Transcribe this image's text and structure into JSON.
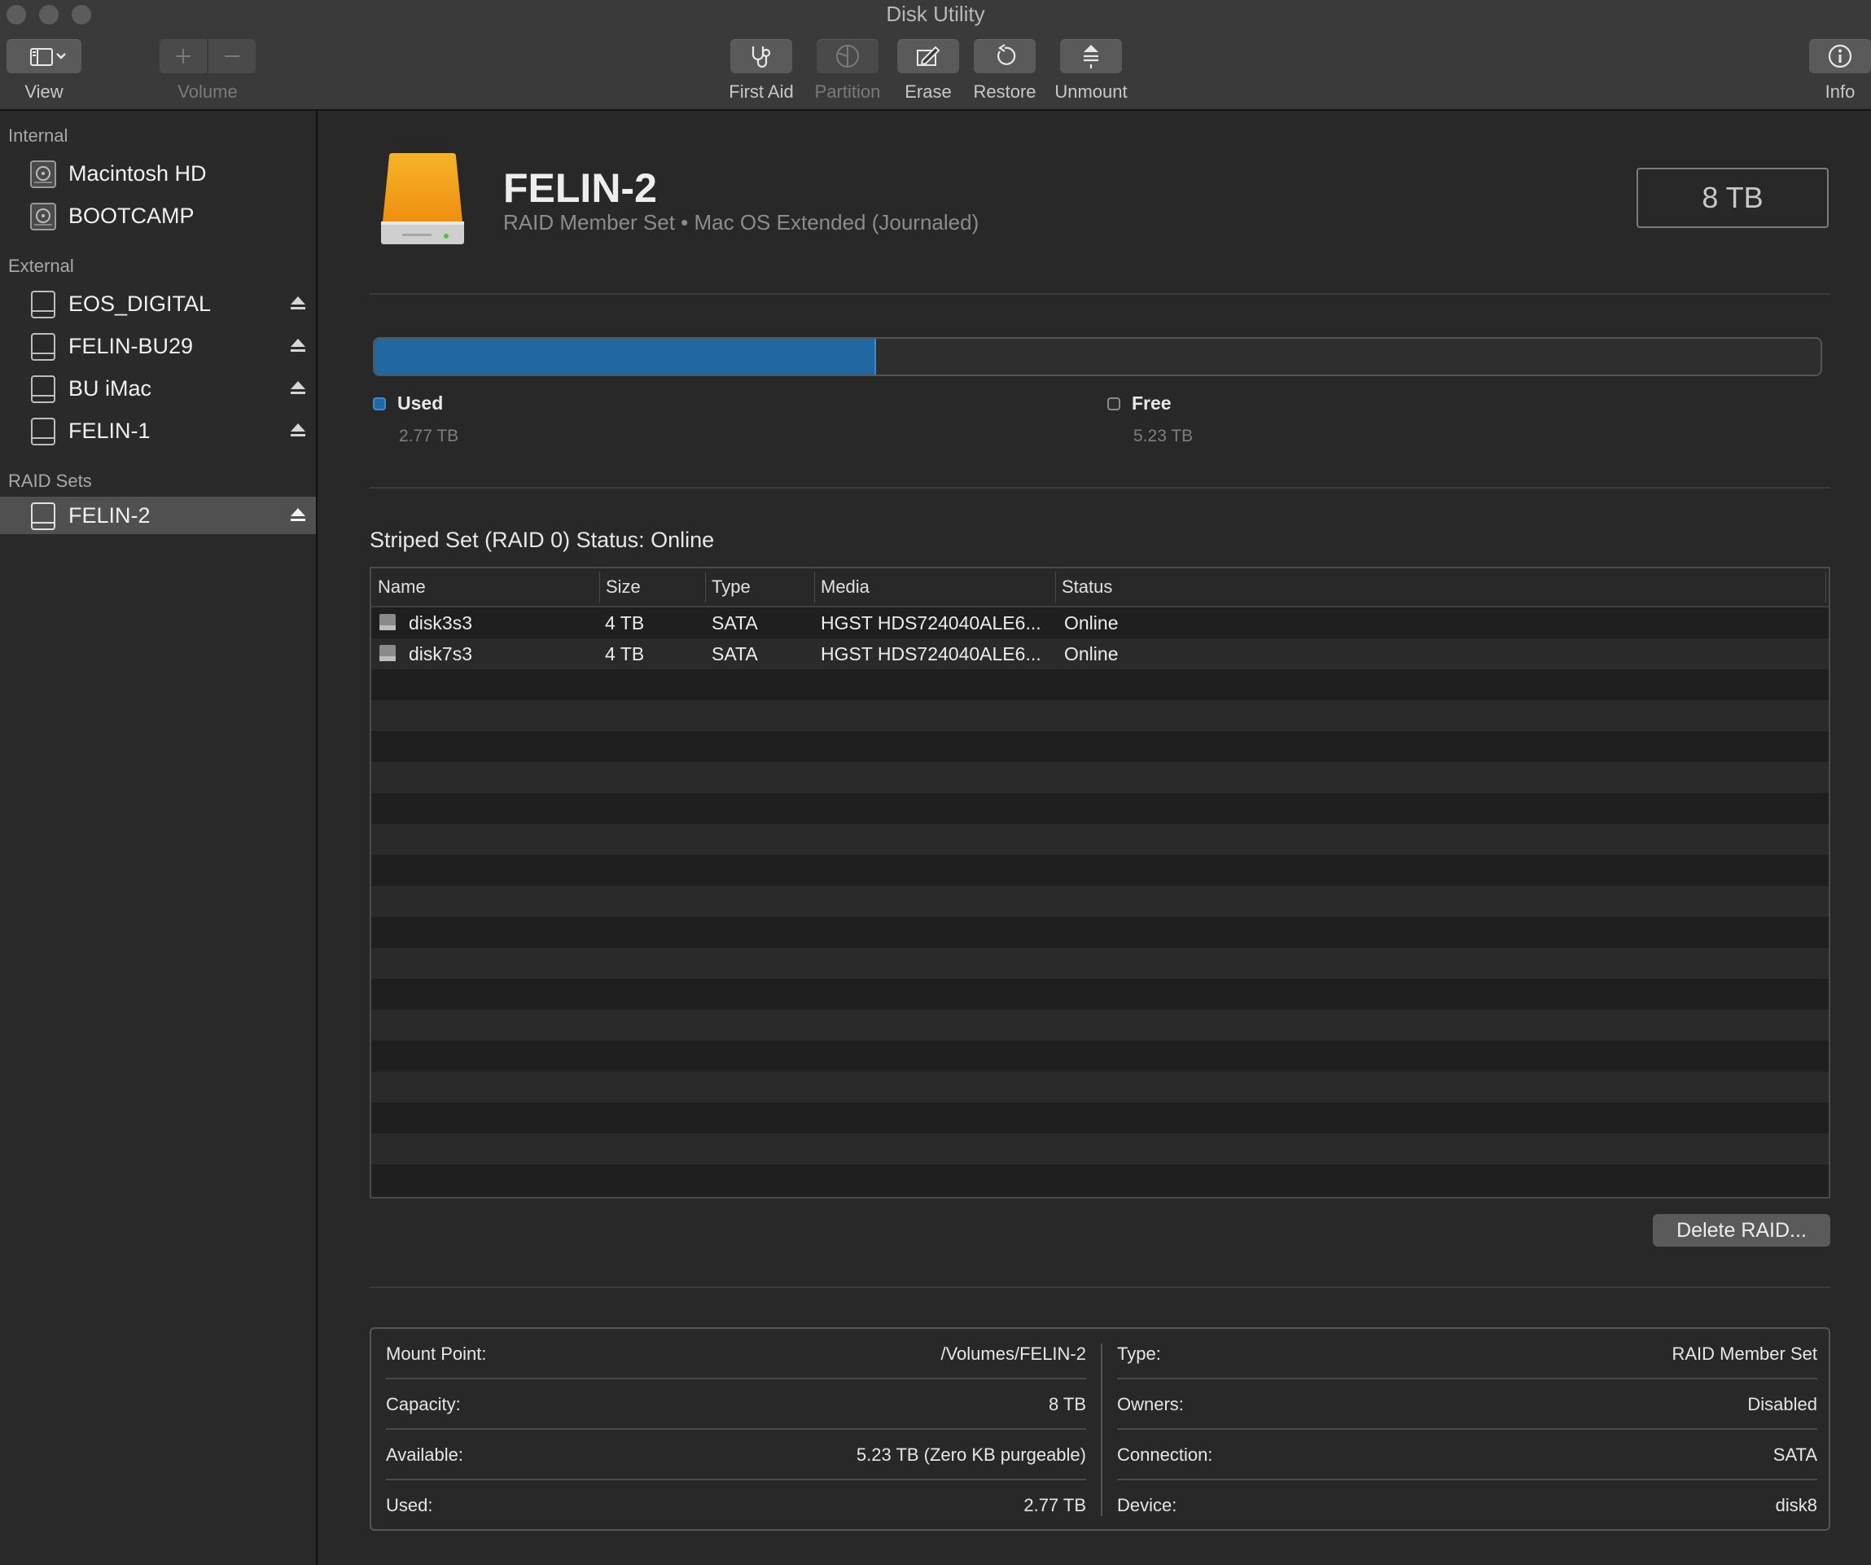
{
  "window": {
    "title": "Disk Utility"
  },
  "toolbar": {
    "view_label": "View",
    "volume_label": "Volume",
    "first_aid_label": "First Aid",
    "partition_label": "Partition",
    "erase_label": "Erase",
    "restore_label": "Restore",
    "unmount_label": "Unmount",
    "info_label": "Info"
  },
  "sidebar": {
    "sections": [
      {
        "title": "Internal",
        "items": [
          {
            "label": "Macintosh HD"
          },
          {
            "label": "BOOTCAMP"
          }
        ]
      },
      {
        "title": "External",
        "items": [
          {
            "label": "EOS_DIGITAL"
          },
          {
            "label": "FELIN-BU29"
          },
          {
            "label": "BU iMac"
          },
          {
            "label": "FELIN-1"
          }
        ]
      },
      {
        "title": "RAID Sets",
        "items": [
          {
            "label": "FELIN-2",
            "selected": true
          }
        ]
      }
    ]
  },
  "volume": {
    "name": "FELIN-2",
    "subtitle": "RAID Member Set • Mac OS Extended (Journaled)",
    "capacity": "8 TB",
    "used_fraction": 0.346
  },
  "usage": {
    "used_label": "Used",
    "used_value": "2.77 TB",
    "free_label": "Free",
    "free_value": "5.23 TB"
  },
  "colors": {
    "used": "#2268a0",
    "accent": "#3a8ad0"
  },
  "raid": {
    "status_title": "Striped Set (RAID 0) Status: Online",
    "columns": [
      "Name",
      "Size",
      "Type",
      "Media",
      "Status"
    ],
    "rows": [
      {
        "name": "disk3s3",
        "size": "4 TB",
        "type": "SATA",
        "media": "HGST HDS724040ALE6...",
        "status": "Online"
      },
      {
        "name": "disk7s3",
        "size": "4 TB",
        "type": "SATA",
        "media": "HGST HDS724040ALE6...",
        "status": "Online"
      }
    ],
    "delete_label": "Delete RAID..."
  },
  "info": {
    "left": [
      {
        "key": "Mount Point:",
        "value": "/Volumes/FELIN-2"
      },
      {
        "key": "Capacity:",
        "value": "8 TB"
      },
      {
        "key": "Available:",
        "value": "5.23 TB (Zero KB purgeable)"
      },
      {
        "key": "Used:",
        "value": "2.77 TB"
      }
    ],
    "right": [
      {
        "key": "Type:",
        "value": "RAID Member Set"
      },
      {
        "key": "Owners:",
        "value": "Disabled"
      },
      {
        "key": "Connection:",
        "value": "SATA"
      },
      {
        "key": "Device:",
        "value": "disk8"
      }
    ]
  }
}
